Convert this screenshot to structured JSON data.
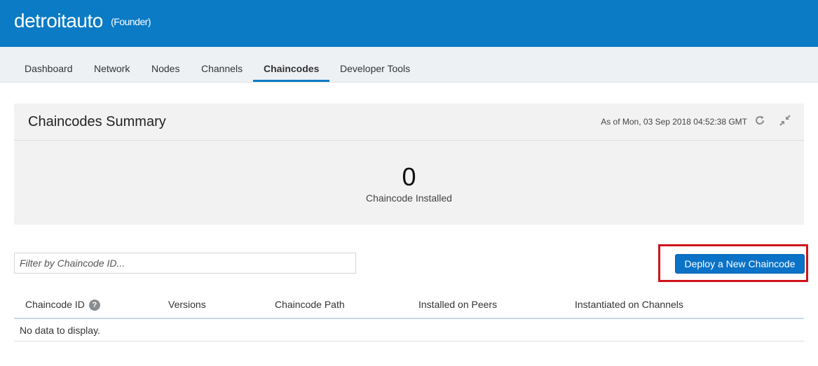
{
  "header": {
    "org_name": "detroitauto",
    "role": "(Founder)"
  },
  "tabs": [
    {
      "label": "Dashboard",
      "active": false
    },
    {
      "label": "Network",
      "active": false
    },
    {
      "label": "Nodes",
      "active": false
    },
    {
      "label": "Channels",
      "active": false
    },
    {
      "label": "Chaincodes",
      "active": true
    },
    {
      "label": "Developer Tools",
      "active": false
    }
  ],
  "summary": {
    "title": "Chaincodes Summary",
    "as_of": "As of Mon, 03 Sep 2018 04:52:38 GMT",
    "count": "0",
    "count_label": "Chaincode Installed",
    "refresh_icon": "refresh-icon",
    "collapse_icon": "collapse-icon"
  },
  "filter": {
    "placeholder": "Filter by Chaincode ID...",
    "value": ""
  },
  "deploy_button": {
    "label": "Deploy a New Chaincode"
  },
  "table": {
    "columns": [
      "Chaincode ID",
      "Versions",
      "Chaincode Path",
      "Installed on Peers",
      "Instantiated on Channels"
    ],
    "help_icon": "?",
    "empty_text": "No data to display."
  },
  "colors": {
    "brand_blue": "#0a7bc4",
    "button_blue": "#0a72c7",
    "highlight_red": "#d0121b"
  }
}
